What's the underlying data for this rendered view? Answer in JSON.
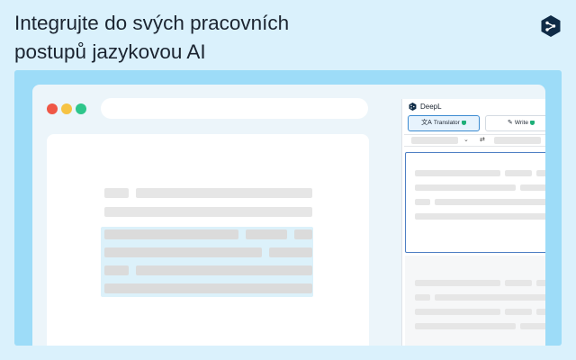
{
  "headline": {
    "line1": "Integrujte do svých pracovních",
    "line2": "postupů jazykovou AI"
  },
  "brand_logo_icon": "deepl-logo-icon",
  "panel": {
    "title": "DeepL",
    "close_glyph": "×",
    "translator_label": "Translator",
    "write_label": "Write",
    "translate_glyph": "文A",
    "write_glyph": "✎",
    "swap_glyph": "⇄",
    "chevron_glyph": "⌄"
  },
  "colors": {
    "background": "#daf1fc",
    "stage": "#9ddcf8",
    "deepl_navy": "#0f2b46",
    "active_tab": "#3c8bd1",
    "badge_green": "#1eaf78",
    "dot_red": "#ef5746",
    "dot_yellow": "#f6c343",
    "dot_green": "#2ec68b"
  }
}
